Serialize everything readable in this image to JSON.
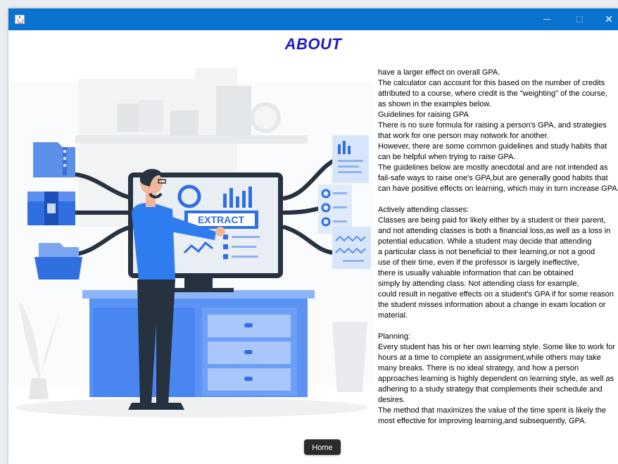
{
  "window": {
    "close_glyph": "✕"
  },
  "page": {
    "heading": "ABOUT"
  },
  "illustration": {
    "screen_button_text": "EXTRACT",
    "colors": {
      "primary": "#2f7bf0",
      "light": "#bcd5fb",
      "dark": "#26323f",
      "grey": "#eef0f2"
    }
  },
  "about_text": "have a larger effect on overall GPA.\nThe calculator can account for this based on the number of credits\nattributed to a course, where credit is the \"weighting\" of the course,\nas shown in the examples below.\nGuidelines for raising GPA\nThere is no sure formula for raising a person's GPA, and strategies\nthat work for one person may notwork for another.\nHowever, there are some common guidelines and study habits that\ncan be helpful when trying to raise GPA.\nThe guidelines below are mostly anecdotal and are not intended as\nfail-safe ways to raise one's GPA,but are generally good habits that\ncan have positive effects on learning, which may in turn increase GPA.\n\nActively attending classes:\nClasses are being paid for likely either by a student or their parent,\nand not attending classes is both a financial loss,as well as a loss in\npotential education. While a student may decide that attending\na particular class is not beneficial to their learning,or not a good\nuse of their time, even if the professor is largely ineffective,\nthere is usually valuable information that can be obtained\nsimply by attending class. Not attending class for example,\ncould result in negative effects on a student's GPA if for some reason\nthe student misses information about a change in exam location or\nmaterial.\n\nPlanning:\nEvery student has his or her own learning style. Some like to work for\nhours at a time to complete an assignment,while others may take\nmany breaks. There is no ideal strategy, and how a person\napproaches learning is highly dependent on learning style, as well as\nadhering to a study strategy that complements their schedule and\ndesires.\nThe method that maximizes the value of the time spent is likely the\nmost effective for improving learning,and subsequently, GPA.",
  "home_button": {
    "label": "Home"
  }
}
